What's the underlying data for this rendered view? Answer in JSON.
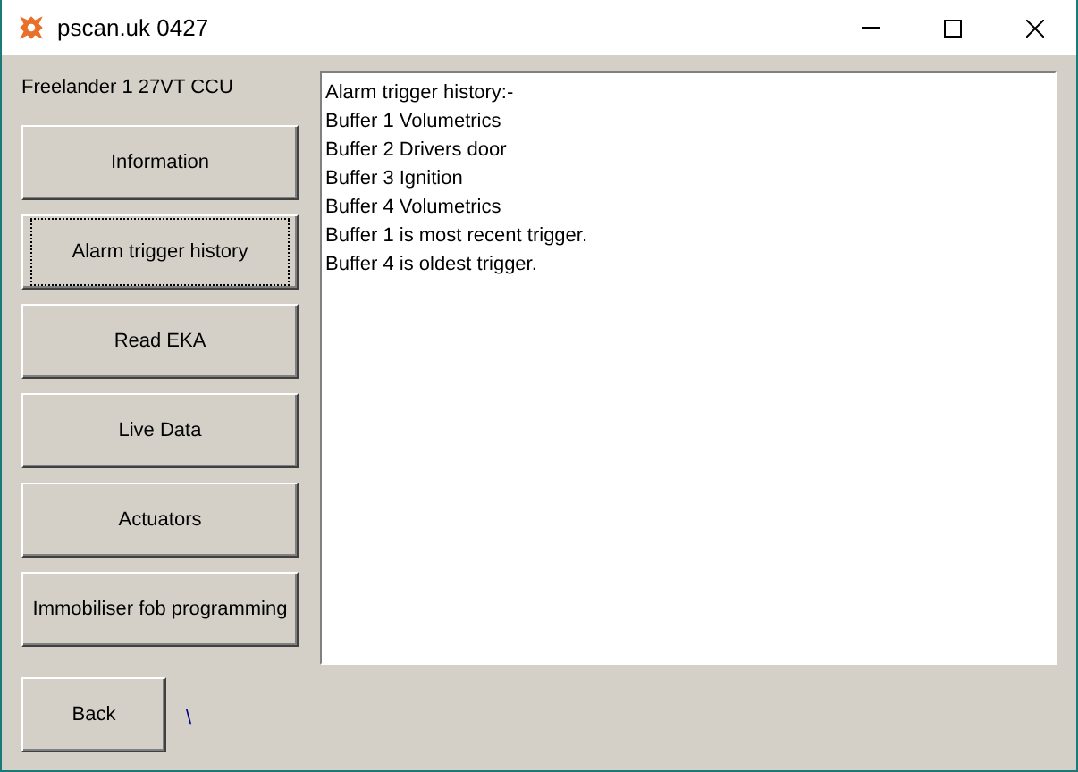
{
  "window": {
    "title": "pscan.uk 0427"
  },
  "vehicle_label": "Freelander 1 27VT CCU",
  "buttons": [
    {
      "label": "Information",
      "focused": false
    },
    {
      "label": "Alarm trigger history",
      "focused": true
    },
    {
      "label": "Read EKA",
      "focused": false
    },
    {
      "label": "Live Data",
      "focused": false
    },
    {
      "label": "Actuators",
      "focused": false
    },
    {
      "label": "Immobiliser fob programming",
      "focused": false
    }
  ],
  "output_lines": [
    "Alarm trigger history:-",
    "Buffer 1 Volumetrics",
    "Buffer 2 Drivers door",
    "Buffer 3 Ignition",
    "Buffer 4 Volumetrics",
    "Buffer 1 is most recent trigger.",
    "Buffer 4 is oldest trigger."
  ],
  "back_button": "Back",
  "status_text": "\\"
}
